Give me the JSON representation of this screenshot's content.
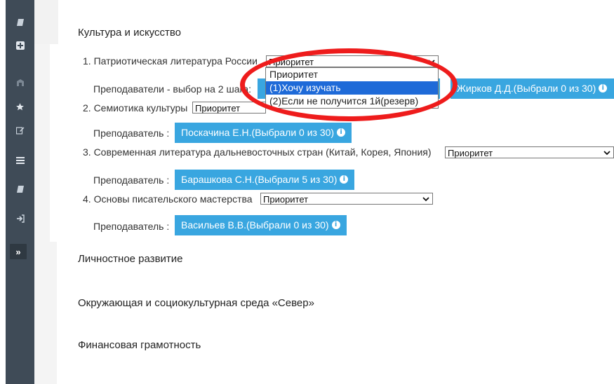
{
  "sidebar": {
    "items": [
      {
        "icon": "book-icon"
      },
      {
        "icon": "plus-square-icon"
      },
      {
        "icon": "columns-icon"
      },
      {
        "icon": "star-icon"
      },
      {
        "icon": "edit-icon"
      },
      {
        "icon": "list-icon"
      },
      {
        "icon": "book-icon"
      },
      {
        "icon": "sign-out-icon"
      },
      {
        "icon": "chevron-right-icon",
        "label": "»"
      }
    ]
  },
  "sections": {
    "culture": {
      "title": "Культура и искусство",
      "items": [
        {
          "label": "1. Патриотическая литература России",
          "select_value": "Приоритет",
          "teacher_label": "Преподаватели - выбор на 2 шага:",
          "buttons": [
            "Жирков Д.Д.(Выбрали 0 из 30)"
          ]
        },
        {
          "label": "2. Семиотика культуры",
          "select_value": "Приоритет",
          "teacher_label": "Преподаватель :",
          "buttons": [
            "Поскачина Е.Н.(Выбрали 0 из 30)"
          ]
        },
        {
          "label": "3. Современная литература дальневосточных стран (Китай, Корея, Япония)",
          "select_value": "Приоритет",
          "teacher_label": "Преподаватель :",
          "buttons": [
            "Барашкова С.Н.(Выбрали 5 из 30)"
          ]
        },
        {
          "label": "4. Основы писательского мастерства",
          "select_value": "Приоритет",
          "teacher_label": "Преподаватель :",
          "buttons": [
            "Васильев В.В.(Выбрали 0 из 30)"
          ]
        }
      ]
    },
    "personal": {
      "title": "Личностное развитие"
    },
    "environment": {
      "title": "Окружающая и социокультурная среда «Север»"
    },
    "finance": {
      "title": "Финансовая грамотность"
    }
  },
  "dropdown": {
    "options": [
      "Приоритет",
      "(1)Хочу изучать",
      "(2)Если не получится 1й(резерв)"
    ],
    "selected_index": 1
  },
  "annotation": {
    "color": "#ee1c1c"
  },
  "colors": {
    "button": "#39a6e0",
    "sidebar": "#3f4b57",
    "option_highlight": "#1e6ad8"
  }
}
